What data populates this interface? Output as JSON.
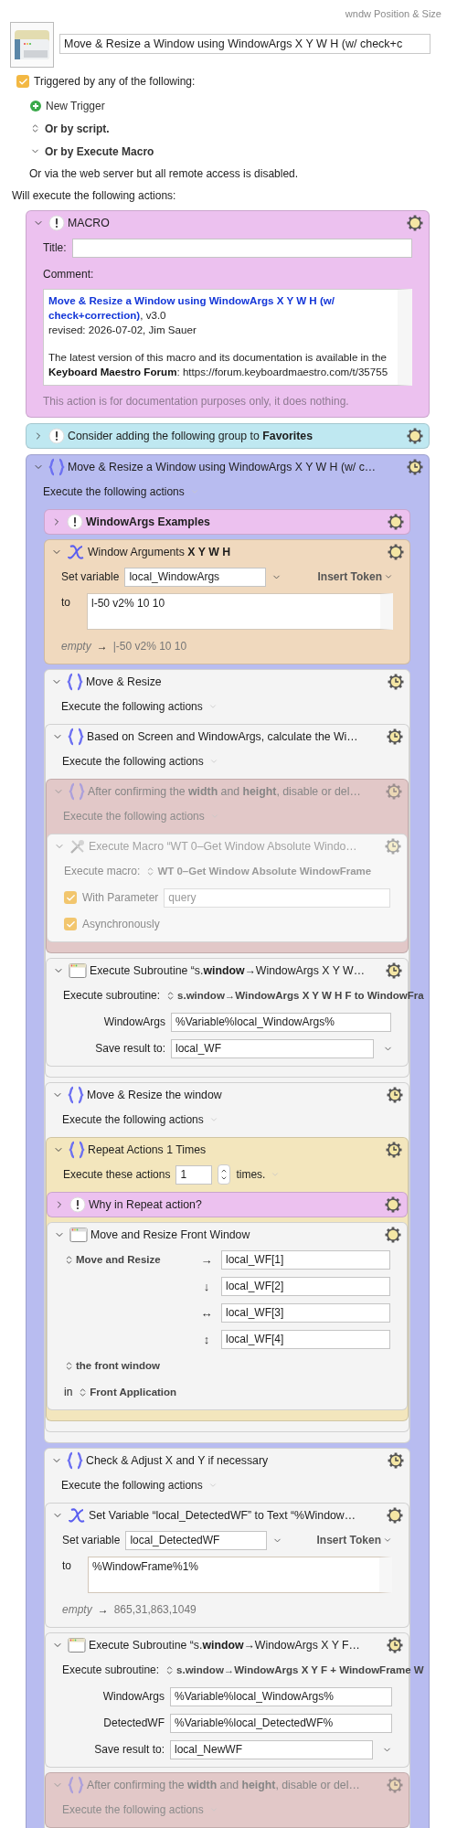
{
  "window": {
    "title": "wndw Position & Size"
  },
  "macro": {
    "name": "Move & Resize a Window using WindowArgs X Y W H (w/ check+c"
  },
  "triggers": {
    "enabled": true,
    "label": "Triggered by any of the following:",
    "items": [
      {
        "kind": "add",
        "label": "New Trigger"
      },
      {
        "kind": "popup",
        "label": "Or by script."
      },
      {
        "kind": "menu",
        "label": "Or by Execute Macro"
      }
    ],
    "note": "Or via the web server but all remote access is disabled."
  },
  "actions_label": "Will execute the following actions:",
  "actions": [
    {
      "kind": "comment",
      "color": "#ecc1ef",
      "expanded": true,
      "disabled": false,
      "title": "MACRO",
      "rows": [
        {
          "kind": "field",
          "label": "Title:"
        },
        {
          "kind": "label",
          "text": "Comment:"
        },
        {
          "kind": "comment_box",
          "paragraphs": [
            {
              "kind": "heading",
              "text": "**Move & Resize a Window using WindowArgs X Y W H (w/ check+correction)**, v3.0"
            },
            {
              "kind": "plain",
              "text": "revised: 2026-07-02, Jim Sauer"
            },
            {
              "kind": "spaced",
              "text": "The latest version of this macro and its documentation is available in the **Keyboard Maestro Forum**: https://forum.keyboardmaestro.com/t/35755"
            }
          ]
        }
      ],
      "footer": "This action is for documentation purposes only, it does nothing."
    },
    {
      "kind": "comment",
      "color": "#bfe8f1",
      "expanded": false,
      "disabled": false,
      "title": "Consider adding the following group to **Favorites**"
    },
    {
      "kind": "group",
      "color": "#b8bcf0",
      "expanded": true,
      "disabled": false,
      "title": "Move & Resize a Window using WindowArgs X Y W H (w/ c…",
      "rows": [
        {
          "kind": "execute",
          "text": "Execute the following actions"
        }
      ],
      "children": [
        {
          "kind": "comment",
          "color": "#ecc1ef",
          "expanded": false,
          "disabled": false,
          "title": "**WindowArgs Examples**"
        },
        {
          "kind": "variable",
          "color": "#f0d9be",
          "expanded": true,
          "disabled": false,
          "title": "Window Arguments **X Y W H**",
          "rows": [
            {
              "kind": "setvar",
              "label": "Set variable",
              "value": "local_WindowArgs",
              "button": "Insert Token"
            },
            {
              "kind": "textarea",
              "label": "to",
              "value": "l-50 v2% 10 10"
            },
            {
              "kind": "preview",
              "label": "empty",
              "arrow": "→",
              "value": "|-50 v2% 10 10"
            }
          ]
        },
        {
          "kind": "group",
          "color": "#f4f4f4",
          "expanded": true,
          "disabled": false,
          "title": "Move & Resize",
          "rows": [
            {
              "kind": "execute",
              "text": "Execute the following actions"
            }
          ],
          "children": [
            {
              "kind": "group",
              "color": "#f4f4f4",
              "expanded": true,
              "disabled": false,
              "title": "Based on Screen and WindowArgs, calculate the Wi…",
              "rows": [
                {
                  "kind": "execute",
                  "text": "Execute the following actions"
                }
              ],
              "children": [
                {
                  "kind": "group",
                  "color": "#e2c8c8",
                  "expanded": true,
                  "disabled": true,
                  "title": "After confirming the **width** and **height**, disable or del…",
                  "rows": [
                    {
                      "kind": "execute",
                      "text": "Execute the following actions"
                    }
                  ],
                  "children": [
                    {
                      "kind": "macro",
                      "color": "#f7f7f7",
                      "expanded": true,
                      "disabled": false,
                      "title": "Execute Macro “WT 0–Get Window Absolute Windo…",
                      "rows": [
                        {
                          "kind": "popup",
                          "label": "Execute macro:",
                          "value": "WT 0–Get Window Absolute WindowFrame"
                        },
                        {
                          "kind": "checkbox",
                          "label": "With Parameter",
                          "checked": true,
                          "placeholder": "query"
                        },
                        {
                          "kind": "checkbox",
                          "label": "Asynchronously",
                          "checked": true
                        }
                      ]
                    }
                  ]
                },
                {
                  "kind": "subroutine",
                  "color": "#f4f4f4",
                  "expanded": true,
                  "disabled": false,
                  "title": "Execute Subroutine “s.**window**→WindowArgs X Y W…",
                  "rows": [
                    {
                      "kind": "popup",
                      "label": "Execute subroutine:",
                      "value": "s.window→WindowArgs X Y W H F to WindowFra"
                    },
                    {
                      "kind": "param",
                      "label": "WindowArgs",
                      "value": "%Variable%local_WindowArgs%"
                    },
                    {
                      "kind": "result",
                      "label": "Save result to:",
                      "value": "local_WF"
                    }
                  ]
                }
              ]
            },
            {
              "kind": "group",
              "color": "#f4f4f4",
              "expanded": true,
              "disabled": false,
              "title": "Move & Resize the window",
              "rows": [
                {
                  "kind": "execute",
                  "text": "Execute the following actions"
                }
              ],
              "children": [
                {
                  "kind": "repeat",
                  "color": "#f3e6bd",
                  "expanded": true,
                  "disabled": false,
                  "title": "Repeat Actions 1 Times",
                  "rows": [
                    {
                      "kind": "repeat",
                      "label": "Execute these actions",
                      "value": "1",
                      "suffix": "times."
                    }
                  ],
                  "children": [
                    {
                      "kind": "comment",
                      "color": "#ecc1ef",
                      "expanded": false,
                      "disabled": false,
                      "title": "Why in Repeat action?"
                    },
                    {
                      "kind": "window",
                      "color": "#f4f4f4",
                      "expanded": true,
                      "disabled": false,
                      "title": "Move and Resize Front Window",
                      "rows": [
                        {
                          "kind": "arrowfield",
                          "label": "Move and Resize",
                          "arrow": "→",
                          "value": "local_WF[1]"
                        },
                        {
                          "kind": "arrowfield",
                          "arrow": "↓",
                          "value": "local_WF[2]"
                        },
                        {
                          "kind": "arrowfield",
                          "arrow": "↔",
                          "value": "local_WF[3]"
                        },
                        {
                          "kind": "arrowfield",
                          "arrow": "↕",
                          "value": "local_WF[4]"
                        },
                        {
                          "kind": "popup",
                          "value": "the front window"
                        },
                        {
                          "kind": "popup",
                          "label": "in",
                          "value": "Front Application"
                        }
                      ]
                    }
                  ]
                }
              ]
            }
          ]
        },
        {
          "kind": "group",
          "color": "#f4f4f4",
          "expanded": true,
          "disabled": false,
          "title": "Check & Adjust X and Y if necessary",
          "rows": [
            {
              "kind": "execute",
              "text": "Execute the following actions"
            }
          ],
          "children": [
            {
              "kind": "variable",
              "color": "#f4f4f4",
              "expanded": true,
              "disabled": false,
              "title": "Set Variable “local_DetectedWF” to Text “%Window…",
              "rows": [
                {
                  "kind": "setvar",
                  "label": "Set variable",
                  "value": "local_DetectedWF",
                  "button": "Insert Token"
                },
                {
                  "kind": "textarea",
                  "label": "to",
                  "value": "%WindowFrame%1%"
                },
                {
                  "kind": "preview",
                  "label": "empty",
                  "arrow": "→",
                  "value": "865,31,863,1049"
                }
              ]
            },
            {
              "kind": "subroutine",
              "color": "#f4f4f4",
              "expanded": true,
              "disabled": false,
              "title": "Execute Subroutine “s.**window**→WindowArgs X Y F…",
              "rows": [
                {
                  "kind": "popup",
                  "label": "Execute subroutine:",
                  "value": "s.window→WindowArgs X Y F + WindowFrame W"
                },
                {
                  "kind": "param",
                  "label": "WindowArgs",
                  "value": "%Variable%local_WindowArgs%"
                },
                {
                  "kind": "param",
                  "label": "DetectedWF",
                  "value": "%Variable%local_DetectedWF%"
                },
                {
                  "kind": "result",
                  "label": "Save result to:",
                  "value": "local_NewWF"
                }
              ]
            },
            {
              "kind": "group",
              "color": "#e2c8c8",
              "expanded": true,
              "disabled": true,
              "title": "After confirming the **width** and **height**, disable or del…",
              "rows": [
                {
                  "kind": "execute",
                  "text": "Execute the following actions"
                }
              ]
            }
          ]
        }
      ]
    }
  ]
}
